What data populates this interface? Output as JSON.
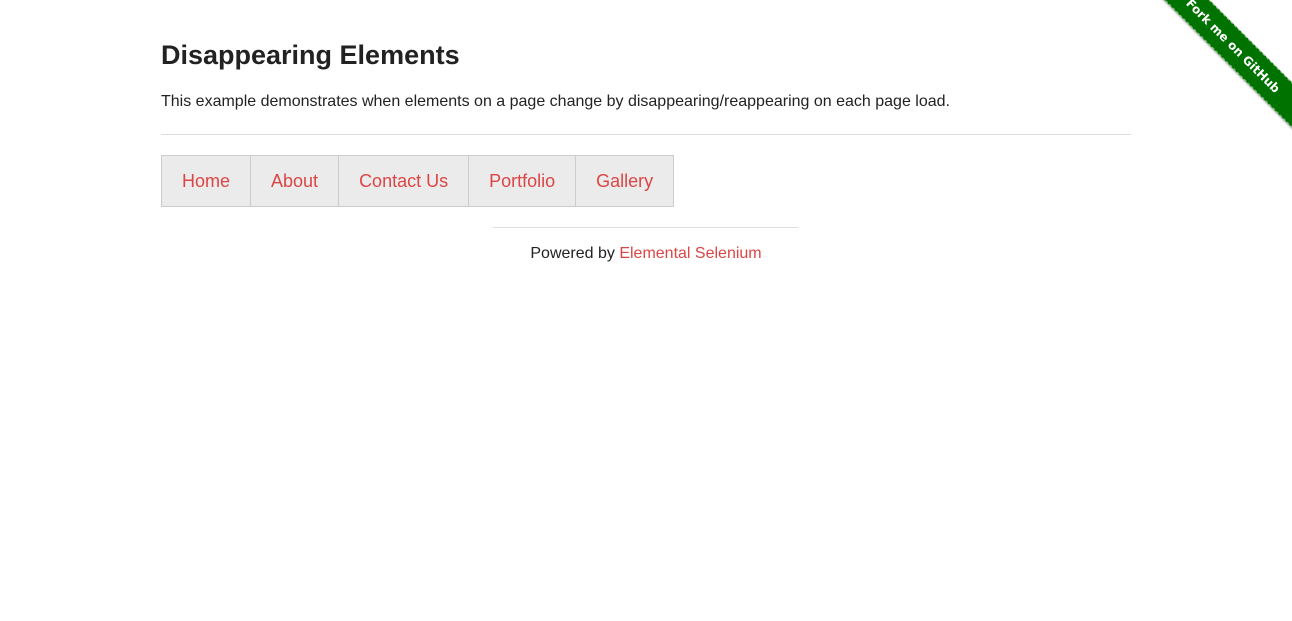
{
  "page": {
    "title": "Disappearing Elements",
    "description": "This example demonstrates when elements on a page change by disappearing/reappearing on each page load."
  },
  "menu": {
    "items": [
      {
        "label": "Home"
      },
      {
        "label": "About"
      },
      {
        "label": "Contact Us"
      },
      {
        "label": "Portfolio"
      },
      {
        "label": "Gallery"
      }
    ]
  },
  "footer": {
    "prefix": "Powered by",
    "link_label": "Elemental Selenium"
  },
  "ribbon": {
    "label": "Fork me on GitHub"
  },
  "colors": {
    "link": "#dc4545",
    "ribbon": "#007200",
    "menu_bg": "#ebebeb"
  }
}
